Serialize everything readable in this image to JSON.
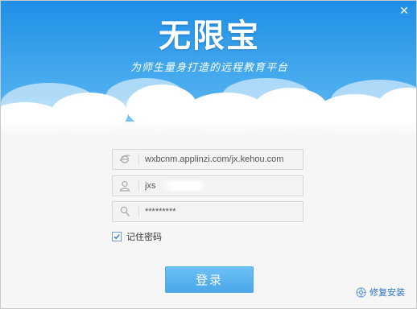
{
  "window": {
    "close_symbol": "✕"
  },
  "header": {
    "logo_text": "无限宝",
    "slogan": "为师生量身打造的远程教育平台"
  },
  "form": {
    "server_value": "wxbcnm.applinzi.com/jx.kehou.com",
    "username_value": "jxs",
    "password_value": "*********",
    "remember_label": "记住密码",
    "remember_checked": true
  },
  "buttons": {
    "login_label": "登录",
    "repair_label": "修复安装"
  },
  "icons": {
    "close": "close-icon",
    "server": "ie-icon",
    "user": "user-icon",
    "password": "key-icon",
    "repair": "repair-icon"
  },
  "colors": {
    "sky_top": "#1f8fe6",
    "sky_bottom": "#7cc8f6",
    "login_button": "#55aee9",
    "link": "#2a6fc0"
  }
}
